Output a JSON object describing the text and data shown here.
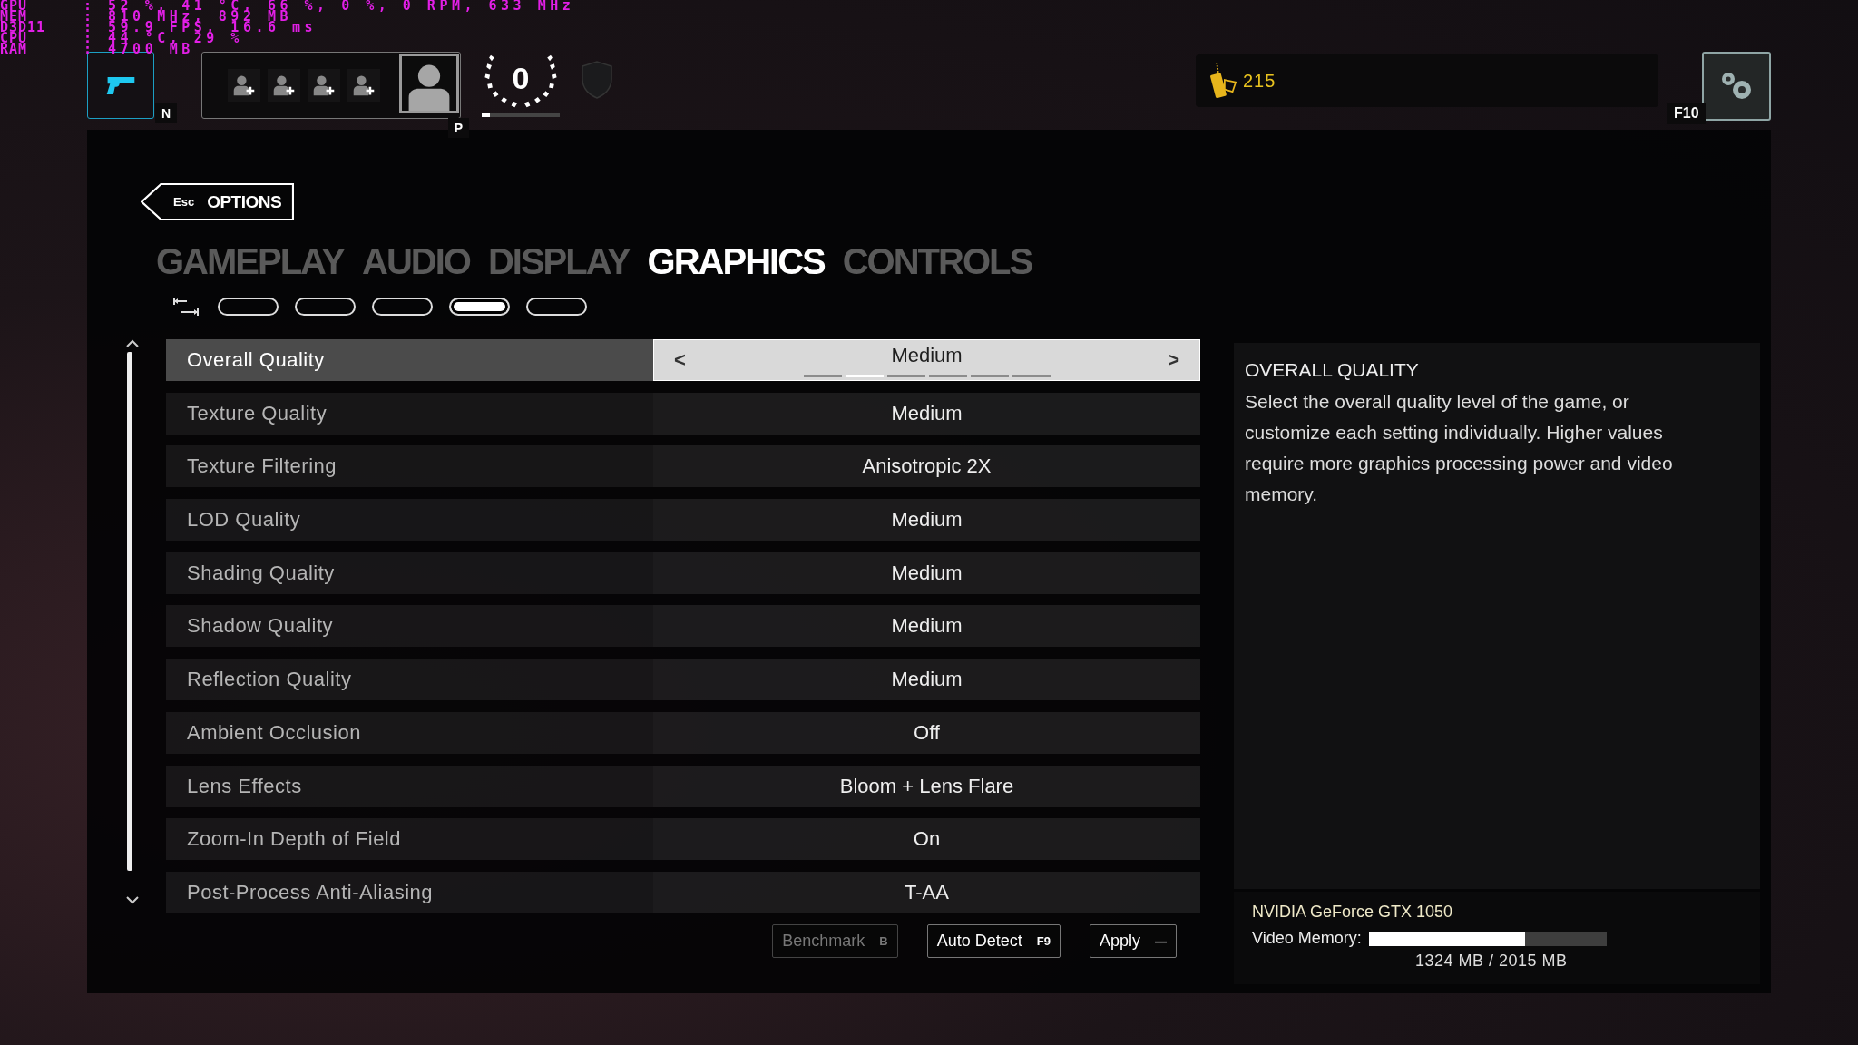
{
  "hardware_overlay": [
    {
      "label": "GPU",
      "value": ": 52 %, 41 °C, 66 %, 0 %, 0 RPM, 633 MHz"
    },
    {
      "label": "MEM",
      "value": ": 810 MHz, 892 MB"
    },
    {
      "label": "D3D11",
      "value": ": 59.9 FPS, 16.6 ms"
    },
    {
      "label": "CPU",
      "value": ": 44 °C, 29 %"
    },
    {
      "label": "RAM",
      "value": ": 4700 MB"
    }
  ],
  "top_bar": {
    "loadout_key": "N",
    "party_key": "P",
    "rank": "0",
    "rank_progress": {
      "level": 0.1
    },
    "currency": "215",
    "settings_key": "F10"
  },
  "back": {
    "key": "Esc",
    "label": "OPTIONS"
  },
  "tabs": [
    {
      "label": "GAMEPLAY",
      "selected": false
    },
    {
      "label": "AUDIO",
      "selected": false
    },
    {
      "label": "DISPLAY",
      "selected": false
    },
    {
      "label": "GRAPHICS",
      "selected": true
    },
    {
      "label": "CONTROLS",
      "selected": false
    }
  ],
  "presets": [
    {
      "selected": false
    },
    {
      "selected": false
    },
    {
      "selected": false
    },
    {
      "selected": true
    },
    {
      "selected": false
    }
  ],
  "settings": [
    {
      "label": "Overall Quality",
      "value": "Medium",
      "selected": true,
      "left_arrow": "<",
      "right_arrow": ">",
      "segments": [
        {
          "selected": false
        },
        {
          "selected": true
        },
        {
          "selected": false
        },
        {
          "selected": false
        },
        {
          "selected": false
        },
        {
          "selected": false
        }
      ]
    },
    {
      "label": "Texture Quality",
      "value": "Medium",
      "selected": false
    },
    {
      "label": "Texture Filtering",
      "value": "Anisotropic 2X",
      "selected": false
    },
    {
      "label": "LOD Quality",
      "value": "Medium",
      "selected": false
    },
    {
      "label": "Shading Quality",
      "value": "Medium",
      "selected": false
    },
    {
      "label": "Shadow Quality",
      "value": "Medium",
      "selected": false
    },
    {
      "label": "Reflection Quality",
      "value": "Medium",
      "selected": false
    },
    {
      "label": "Ambient Occlusion",
      "value": "Off",
      "selected": false
    },
    {
      "label": "Lens Effects",
      "value": "Bloom + Lens Flare",
      "selected": false
    },
    {
      "label": "Zoom-In Depth of Field",
      "value": "On",
      "selected": false
    },
    {
      "label": "Post-Process Anti-Aliasing",
      "value": "T-AA",
      "selected": false
    }
  ],
  "buttons": [
    {
      "label": "Benchmark",
      "key": "B",
      "disabled": true
    },
    {
      "label": "Auto Detect",
      "key": "F9",
      "disabled": false
    },
    {
      "label": "Apply",
      "key": "—",
      "disabled": false
    }
  ],
  "description": {
    "title": "OVERALL QUALITY",
    "text": "Select the overall quality level of the game, or customize each setting individually. Higher values require more graphics processing power and video memory."
  },
  "gpu": {
    "name": "NVIDIA GeForce GTX 1050",
    "memory_label": "Video Memory:",
    "memory": {
      "level": 0.657
    },
    "memory_reading": "1324 MB / 2015 MB"
  }
}
